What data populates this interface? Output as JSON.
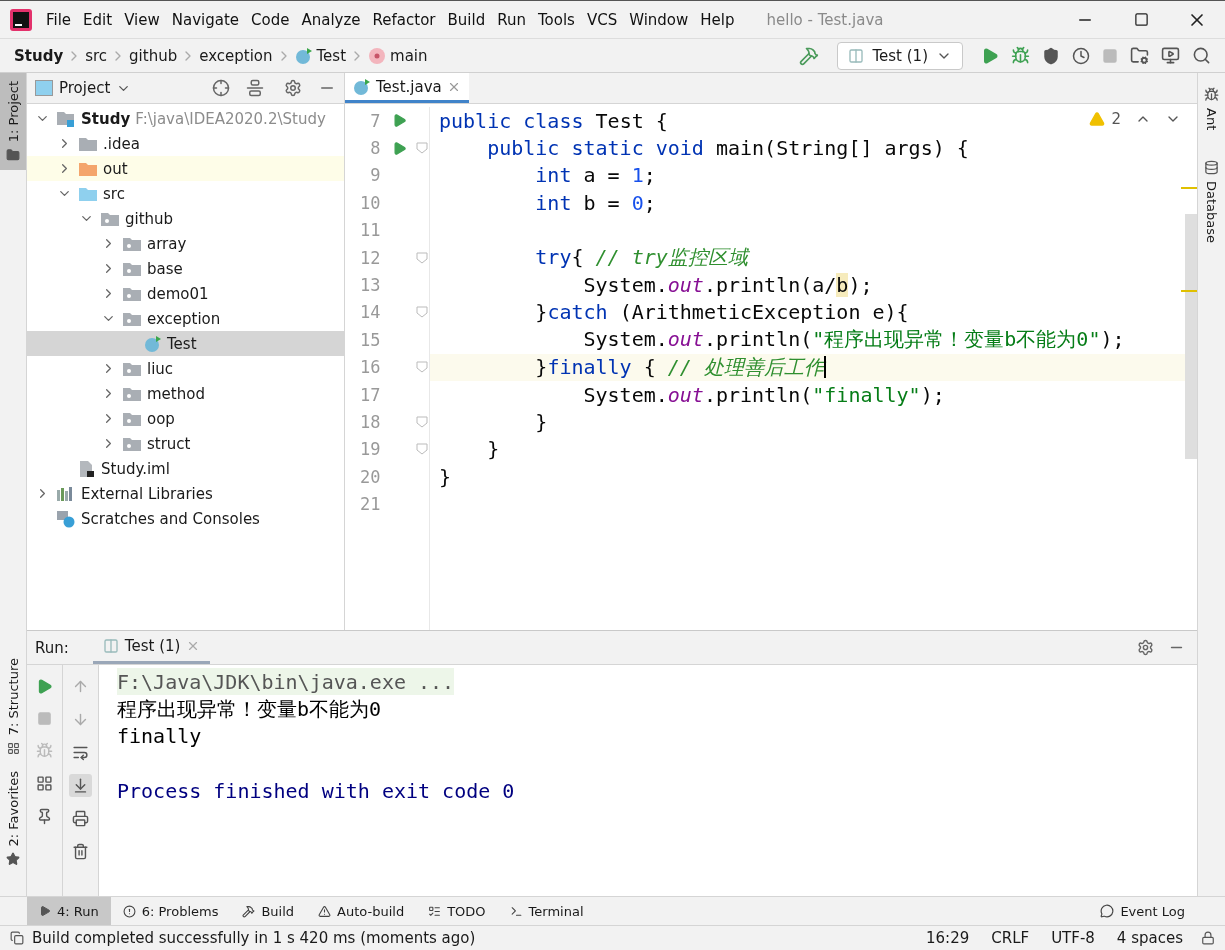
{
  "window": {
    "title": "hello - Test.java"
  },
  "menu": [
    "File",
    "Edit",
    "View",
    "Navigate",
    "Code",
    "Analyze",
    "Refactor",
    "Build",
    "Run",
    "Tools",
    "VCS",
    "Window",
    "Help"
  ],
  "breadcrumbs": [
    {
      "label": "Study",
      "kind": "project"
    },
    {
      "label": "src",
      "kind": "folder"
    },
    {
      "label": "github",
      "kind": "folder"
    },
    {
      "label": "exception",
      "kind": "folder"
    },
    {
      "label": "Test",
      "kind": "class"
    },
    {
      "label": "main",
      "kind": "method"
    }
  ],
  "run_config": "Test (1)",
  "left_stripe": [
    {
      "label": "1: Project",
      "kind": "project",
      "selected": true
    },
    {
      "label": "7: Structure",
      "kind": "structure",
      "selected": false
    },
    {
      "label": "2: Favorites",
      "kind": "favorites",
      "selected": false
    }
  ],
  "right_stripe": [
    {
      "label": "Ant",
      "kind": "ant"
    },
    {
      "label": "Database",
      "kind": "database"
    }
  ],
  "project_panel": {
    "title": "Project",
    "tree": [
      {
        "label": "Study",
        "hint": "F:\\java\\IDEA2020.2\\Study",
        "kind": "module",
        "expanded": true,
        "selected": false,
        "children": [
          {
            "label": ".idea",
            "kind": "folder",
            "expanded": false,
            "selected": false
          },
          {
            "label": "out",
            "kind": "excluded",
            "expanded": false,
            "selected": false,
            "highlighted": true
          },
          {
            "label": "src",
            "kind": "source",
            "expanded": true,
            "selected": false,
            "children": [
              {
                "label": "github",
                "kind": "package",
                "expanded": true,
                "selected": false,
                "children": [
                  {
                    "label": "array",
                    "kind": "package",
                    "expanded": false,
                    "selected": false
                  },
                  {
                    "label": "base",
                    "kind": "package",
                    "expanded": false,
                    "selected": false
                  },
                  {
                    "label": "demo01",
                    "kind": "package",
                    "expanded": false,
                    "selected": false
                  },
                  {
                    "label": "exception",
                    "kind": "package",
                    "expanded": true,
                    "selected": false,
                    "children": [
                      {
                        "label": "Test",
                        "kind": "class",
                        "selected": true
                      }
                    ]
                  },
                  {
                    "label": "liuc",
                    "kind": "package",
                    "expanded": false,
                    "selected": false
                  },
                  {
                    "label": "method",
                    "kind": "package",
                    "expanded": false,
                    "selected": false
                  },
                  {
                    "label": "oop",
                    "kind": "package",
                    "expanded": false,
                    "selected": false
                  },
                  {
                    "label": "struct",
                    "kind": "package",
                    "expanded": false,
                    "selected": false
                  }
                ]
              }
            ]
          },
          {
            "label": "Study.iml",
            "kind": "iml",
            "selected": false
          }
        ]
      },
      {
        "label": "External Libraries",
        "kind": "libraries",
        "expanded": false,
        "selected": false
      },
      {
        "label": "Scratches and Consoles",
        "kind": "scratches",
        "selected": false
      }
    ]
  },
  "editor": {
    "tabs": [
      {
        "label": "Test.java",
        "selected": true
      }
    ],
    "warnings": "2",
    "lines": [
      {
        "number": "7",
        "run": true,
        "fold": false,
        "current": false,
        "tokens": [
          {
            "kind": "keyword",
            "text": "public class "
          },
          {
            "kind": "plain",
            "text": "Test {"
          }
        ]
      },
      {
        "number": "8",
        "run": true,
        "fold": true,
        "current": false,
        "tokens": [
          {
            "kind": "keyword",
            "text": "    public static void "
          },
          {
            "kind": "plain",
            "text": "main(String[] args) {"
          }
        ]
      },
      {
        "number": "9",
        "run": false,
        "fold": false,
        "current": false,
        "tokens": [
          {
            "kind": "keyword",
            "text": "        int "
          },
          {
            "kind": "plain",
            "text": "a = "
          },
          {
            "kind": "number",
            "text": "1"
          },
          {
            "kind": "plain",
            "text": ";"
          }
        ]
      },
      {
        "number": "10",
        "run": false,
        "fold": false,
        "current": false,
        "tokens": [
          {
            "kind": "keyword",
            "text": "        int "
          },
          {
            "kind": "plain",
            "text": "b = "
          },
          {
            "kind": "number",
            "text": "0"
          },
          {
            "kind": "plain",
            "text": ";"
          }
        ]
      },
      {
        "number": "11",
        "run": false,
        "fold": false,
        "current": false
      },
      {
        "number": "12",
        "run": false,
        "fold": true,
        "current": false,
        "tokens": [
          {
            "kind": "keyword",
            "text": "        try"
          },
          {
            "kind": "plain",
            "text": "{ "
          },
          {
            "kind": "comment",
            "text": "// try监控区域"
          }
        ]
      },
      {
        "number": "13",
        "run": false,
        "fold": false,
        "current": false,
        "tokens": [
          {
            "kind": "plain",
            "text": "            System."
          },
          {
            "kind": "field",
            "text": "out"
          },
          {
            "kind": "plain",
            "text": ".println(a/"
          },
          {
            "kind": "warning",
            "text": "b"
          },
          {
            "kind": "plain",
            "text": ");"
          }
        ]
      },
      {
        "number": "14",
        "run": false,
        "fold": true,
        "current": false,
        "tokens": [
          {
            "kind": "plain",
            "text": "        }"
          },
          {
            "kind": "keyword",
            "text": "catch "
          },
          {
            "kind": "plain",
            "text": "(ArithmeticException e){"
          }
        ]
      },
      {
        "number": "15",
        "run": false,
        "fold": false,
        "current": false,
        "tokens": [
          {
            "kind": "plain",
            "text": "            System."
          },
          {
            "kind": "field",
            "text": "out"
          },
          {
            "kind": "plain",
            "text": ".println("
          },
          {
            "kind": "string",
            "text": "\"程序出现异常！变量b不能为0\""
          },
          {
            "kind": "plain",
            "text": ");"
          }
        ]
      },
      {
        "number": "16",
        "run": false,
        "fold": true,
        "current": true,
        "tokens": [
          {
            "kind": "plain",
            "text": "        }"
          },
          {
            "kind": "keyword",
            "text": "finally "
          },
          {
            "kind": "plain",
            "text": "{ "
          },
          {
            "kind": "comment",
            "text": "// 处理善后工作"
          }
        ]
      },
      {
        "number": "17",
        "run": false,
        "fold": false,
        "current": false,
        "tokens": [
          {
            "kind": "plain",
            "text": "            System."
          },
          {
            "kind": "field",
            "text": "out"
          },
          {
            "kind": "plain",
            "text": ".println("
          },
          {
            "kind": "string",
            "text": "\"finally\""
          },
          {
            "kind": "plain",
            "text": ");"
          }
        ]
      },
      {
        "number": "18",
        "run": false,
        "fold": true,
        "current": false,
        "tokens": [
          {
            "kind": "plain",
            "text": "        }"
          }
        ]
      },
      {
        "number": "19",
        "run": false,
        "fold": true,
        "current": false,
        "tokens": [
          {
            "kind": "plain",
            "text": "    }"
          }
        ]
      },
      {
        "number": "20",
        "run": false,
        "fold": false,
        "current": false,
        "tokens": [
          {
            "kind": "plain",
            "text": "}"
          }
        ]
      },
      {
        "number": "21",
        "run": false,
        "fold": false,
        "current": false
      }
    ]
  },
  "run_panel": {
    "label": "Run:",
    "tabs": [
      {
        "label": "Test (1)",
        "selected": true
      }
    ],
    "console": [
      {
        "kind": "command",
        "text": "F:\\Java\\JDK\\bin\\java.exe ..."
      },
      {
        "kind": "output",
        "text": "程序出现异常！变量b不能为0"
      },
      {
        "kind": "output",
        "text": "finally"
      },
      {
        "kind": "system",
        "text": "Process finished with exit code 0"
      }
    ]
  },
  "tool_windows": [
    {
      "label": "4: Run",
      "kind": "run",
      "selected": true
    },
    {
      "label": "6: Problems",
      "kind": "problems",
      "selected": false
    },
    {
      "label": "Build",
      "kind": "build",
      "selected": false
    },
    {
      "label": "Auto-build",
      "kind": "autobuild",
      "selected": false
    },
    {
      "label": "TODO",
      "kind": "todo",
      "selected": false
    },
    {
      "label": "Terminal",
      "kind": "terminal",
      "selected": false
    }
  ],
  "event_log": "Event Log",
  "status_bar": {
    "message": "Build completed successfully in 1 s 420 ms (moments ago)",
    "items": [
      "16:29",
      "CRLF",
      "UTF-8",
      "4 spaces"
    ]
  }
}
